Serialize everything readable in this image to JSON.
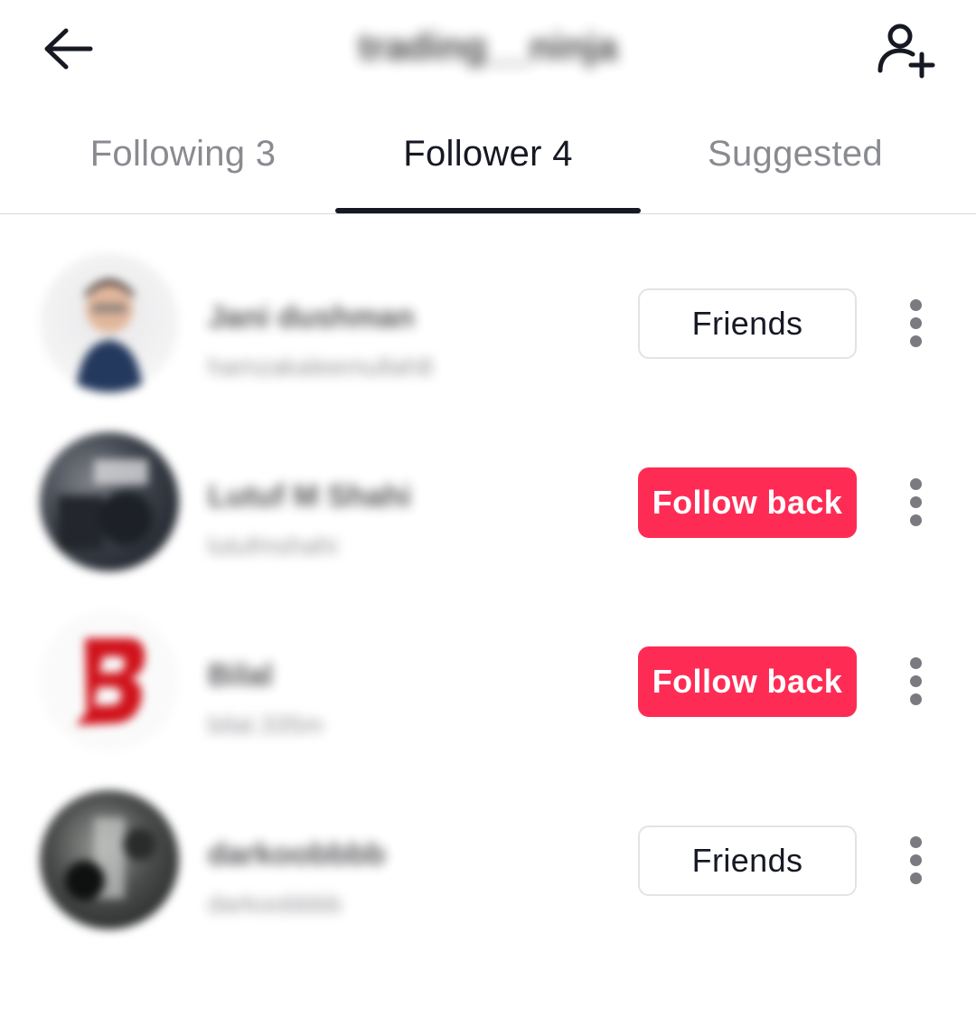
{
  "header": {
    "title": "trading__ninja",
    "back_icon": "arrow-left-icon",
    "add_user_icon": "person-plus-icon"
  },
  "tabs": [
    {
      "label": "Following 3",
      "active": false
    },
    {
      "label": "Follower 4",
      "active": true
    },
    {
      "label": "Suggested",
      "active": false
    }
  ],
  "followers": [
    {
      "name": "Jani dushman",
      "handle": "hamzakaleemullah8",
      "button": "Friends",
      "button_type": "friends"
    },
    {
      "name": "Lutuf M Shahi",
      "handle": "lutufmshahi",
      "button": "Follow back",
      "button_type": "follow"
    },
    {
      "name": "Bilal",
      "handle": "bilal.335m",
      "button": "Follow back",
      "button_type": "follow"
    },
    {
      "name": "darkoobbbb",
      "handle": "darkoobbbb",
      "button": "Friends",
      "button_type": "friends"
    }
  ],
  "colors": {
    "accent": "#fe2c55",
    "text_primary": "#161823",
    "text_secondary": "#8a8b91"
  }
}
